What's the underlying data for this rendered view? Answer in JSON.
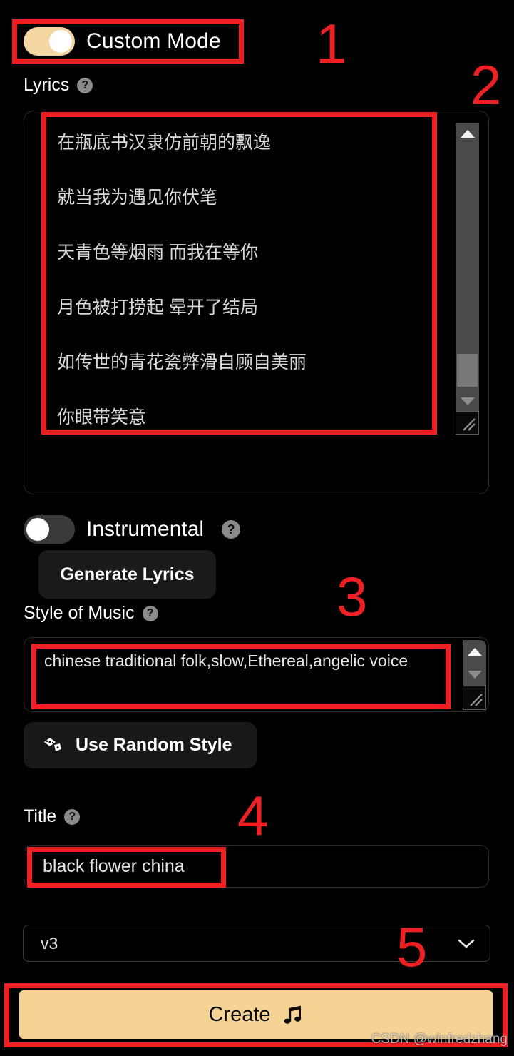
{
  "theme": {
    "background": "#000000",
    "accent": "#f5d394",
    "annotation_red": "#ee2024",
    "panel_border": "#2a2a2a"
  },
  "custom_mode": {
    "label": "Custom Mode",
    "state": "on"
  },
  "lyrics": {
    "label": "Lyrics",
    "help": "?",
    "lines": [
      "在瓶底书汉隶仿前朝的飘逸",
      "就当我为遇见你伏笔",
      "天青色等烟雨 而我在等你",
      "月色被打捞起 晕开了结局",
      "如传世的青花瓷弊滑自顾自美丽",
      "你眼带笑意"
    ],
    "generate_button": "Generate Lyrics"
  },
  "instrumental": {
    "label": "Instrumental",
    "help": "?",
    "state": "off"
  },
  "style_of_music": {
    "label": "Style of Music",
    "help": "?",
    "value": "chinese traditional folk,slow,Ethereal,angelic voice",
    "random_button": "Use Random Style"
  },
  "title": {
    "label": "Title",
    "help": "?",
    "value": "black flower china"
  },
  "version": {
    "selected": "v3"
  },
  "create": {
    "label": "Create",
    "icon": "music-note-icon"
  },
  "annotations": {
    "numbers": [
      "1",
      "2",
      "3",
      "4",
      "5"
    ]
  },
  "watermark": "CSDN @winfredzhang"
}
